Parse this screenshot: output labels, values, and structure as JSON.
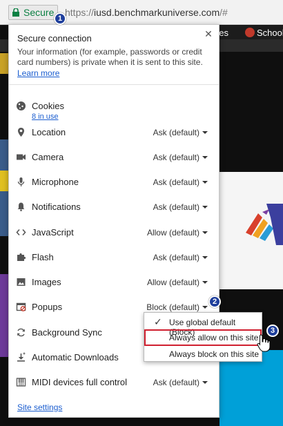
{
  "omnibox": {
    "secure_label": "Secure",
    "url_scheme": "https://",
    "url_host": "iusd.benchmarkuniverse.com",
    "url_rest": "/#"
  },
  "background": {
    "nav_text_1": "ries",
    "nav_text_2": "School"
  },
  "popup": {
    "title": "Secure connection",
    "description": "Your information (for example, passwords or credit card numbers) is private when it is sent to this site.",
    "learn_more": "Learn more",
    "cookies": {
      "label": "Cookies",
      "sublink": "8 in use"
    },
    "permissions": [
      {
        "key": "location",
        "label": "Location",
        "value": "Ask (default)",
        "icon": "location-pin-icon"
      },
      {
        "key": "camera",
        "label": "Camera",
        "value": "Ask (default)",
        "icon": "camera-icon"
      },
      {
        "key": "microphone",
        "label": "Microphone",
        "value": "Ask (default)",
        "icon": "microphone-icon"
      },
      {
        "key": "notifications",
        "label": "Notifications",
        "value": "Ask (default)",
        "icon": "bell-icon"
      },
      {
        "key": "javascript",
        "label": "JavaScript",
        "value": "Allow (default)",
        "icon": "code-brackets-icon"
      },
      {
        "key": "flash",
        "label": "Flash",
        "value": "Ask (default)",
        "icon": "puzzle-icon"
      },
      {
        "key": "images",
        "label": "Images",
        "value": "Allow (default)",
        "icon": "image-icon"
      },
      {
        "key": "popups",
        "label": "Popups",
        "value": "Block (default)",
        "icon": "popup-blocked-icon"
      },
      {
        "key": "background_sync",
        "label": "Background Sync",
        "value": "",
        "icon": "sync-icon"
      },
      {
        "key": "automatic_downloads",
        "label": "Automatic Downloads",
        "value": "",
        "icon": "download-icon"
      },
      {
        "key": "midi",
        "label": "MIDI devices full control",
        "value": "Ask (default)",
        "icon": "piano-keys-icon"
      }
    ],
    "site_settings": "Site settings"
  },
  "dropdown": {
    "items": [
      {
        "label": "Use global default (Block)",
        "checked": true
      },
      {
        "label": "Always allow on this site",
        "checked": false,
        "highlighted": true
      },
      {
        "label": "Always block on this site",
        "checked": false
      }
    ]
  },
  "badges": [
    "1",
    "2",
    "3"
  ],
  "colors": {
    "secure_green": "#0b8043",
    "link_blue": "#1a5dcf",
    "badge_blue": "#1f3f9c",
    "highlight_red": "#d01f2f"
  }
}
